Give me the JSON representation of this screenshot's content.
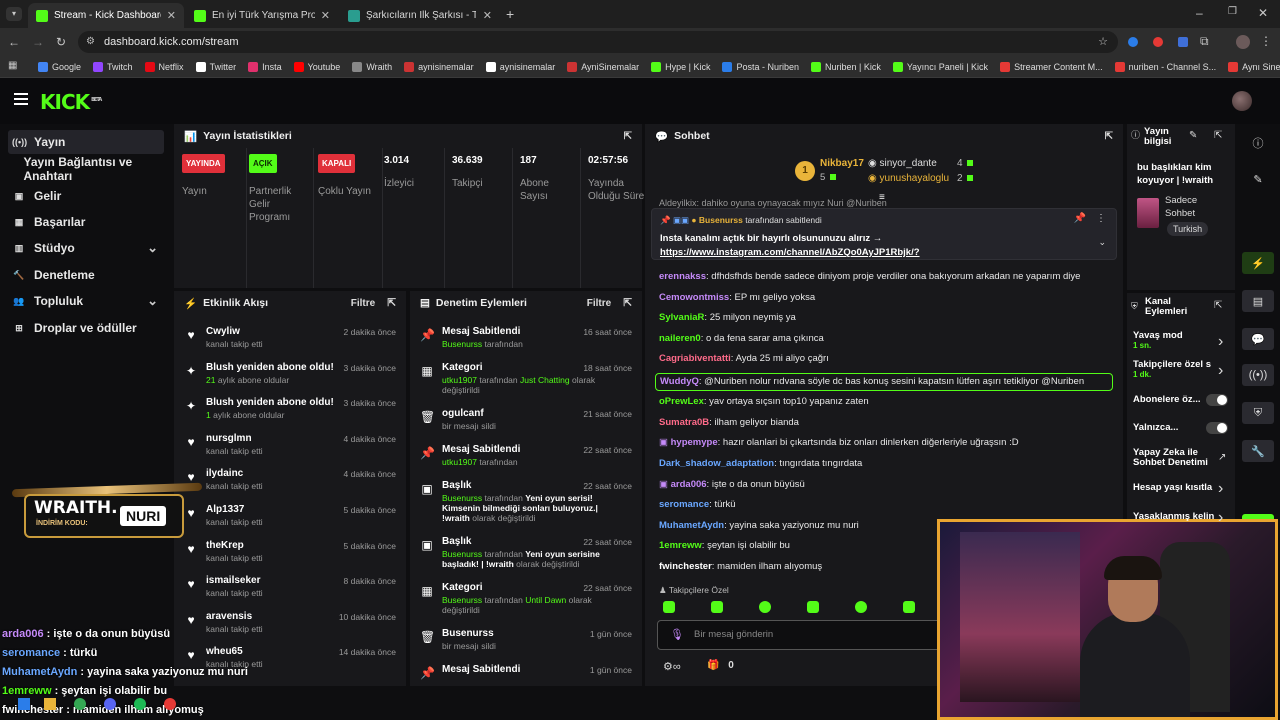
{
  "browser": {
    "tabs": [
      {
        "label": "Stream - Kick Dashboard",
        "active": true,
        "color": "#53fc18"
      },
      {
        "label": "En iyi Türk Yarışma Programı? -",
        "active": false,
        "color": "#53fc18"
      },
      {
        "label": "Şarkıcıların İlk Şarkısı - Tier List",
        "active": false,
        "color": "#2a9d8f"
      }
    ],
    "url": "dashboard.kick.com/stream",
    "bookmarks": [
      "Google",
      "Twitch",
      "Netflix",
      "Twitter",
      "Insta",
      "Youtube",
      "Wraith",
      "aynisinemalar",
      "aynisinemalar",
      "AyniSinemalar",
      "Hype | Kick",
      "Posta - Nuriben",
      "Nuriben | Kick",
      "Yayıncı Paneli | Kick",
      "Streamer Content M...",
      "nuriben - Channel S...",
      "Aynı Sinemalar - Ça..."
    ]
  },
  "brand": {
    "logo": "KICK",
    "beta": "BETA",
    "accent": "#53fc18"
  },
  "sidebar": [
    {
      "label": "Yayın",
      "icon": "broadcast-icon",
      "active": true
    },
    {
      "label": "Yayın Bağlantısı ve Anahtarı",
      "icon": "",
      "active": false
    },
    {
      "label": "Gelir",
      "icon": "wallet-icon",
      "active": false
    },
    {
      "label": "Başarılar",
      "icon": "achievements-icon",
      "active": false
    },
    {
      "label": "Stüdyo",
      "icon": "studio-icon",
      "active": false,
      "chevron": true
    },
    {
      "label": "Denetleme",
      "icon": "moderation-icon",
      "active": false
    },
    {
      "label": "Topluluk",
      "icon": "community-icon",
      "active": false,
      "chevron": true
    },
    {
      "label": "Droplar ve ödüller",
      "icon": "drops-icon",
      "active": false
    }
  ],
  "stats": {
    "title": "Yayın İstatistikleri",
    "items": [
      {
        "badge": "YAYINDA",
        "badge_bg": "#e0303a",
        "label": "Yayın"
      },
      {
        "badge": "AÇIK",
        "badge_bg": "#53fc18",
        "label": "Partnerlik Gelir Programı"
      },
      {
        "badge": "KAPALI",
        "badge_bg": "#e0303a",
        "label": "Çoklu Yayın"
      },
      {
        "value": "3.014",
        "label": "İzleyici"
      },
      {
        "value": "36.639",
        "label": "Takipçi"
      },
      {
        "value": "187",
        "label": "Abone Sayısı"
      },
      {
        "value": "02:57:56",
        "label": "Yayında Olduğu Süre"
      }
    ]
  },
  "activity": {
    "title": "Etkinlik Akışı",
    "filter": "Filtre",
    "items": [
      {
        "icon": "heart",
        "name": "Cwyliw",
        "sub": "kanalı takip etti",
        "time": "2 dakika önce"
      },
      {
        "icon": "sparkle",
        "name": "Blush yeniden abone oldu!",
        "sub_hl": "21",
        "sub": " aylık abone oldular",
        "time": "3 dakika önce"
      },
      {
        "icon": "sparkle",
        "name": "Blush yeniden abone oldu!",
        "sub_hl": "1",
        "sub": " aylık abone oldular",
        "time": "3 dakika önce"
      },
      {
        "icon": "heart",
        "name": "nursglmn",
        "sub": "kanalı takip etti",
        "time": "4 dakika önce"
      },
      {
        "icon": "heart",
        "name": "ilydainc",
        "sub": "kanalı takip etti",
        "time": "4 dakika önce"
      },
      {
        "icon": "heart",
        "name": "Alp1337",
        "sub": "kanalı takip etti",
        "time": "5 dakika önce"
      },
      {
        "icon": "heart",
        "name": "theKrep",
        "sub": "kanalı takip etti",
        "time": "5 dakika önce"
      },
      {
        "icon": "heart",
        "name": "ismailseker",
        "sub": "kanalı takip etti",
        "time": "8 dakika önce"
      },
      {
        "icon": "heart",
        "name": "aravensis",
        "sub": "kanalı takip etti",
        "time": "10 dakika önce"
      },
      {
        "icon": "heart",
        "name": "wheu65",
        "sub": "kanalı takip etti",
        "time": "14 dakika önce"
      }
    ]
  },
  "modlog": {
    "title": "Denetim Eylemleri",
    "filter": "Filtre",
    "items": [
      {
        "icon": "pin",
        "title": "Mesaj Sabitlendi",
        "sub_hl": "Busenurss",
        "sub": " tarafından",
        "time": "16 saat önce",
        "h": 36
      },
      {
        "icon": "cat",
        "title": "Kategori",
        "sub_hl": "utku1907",
        "sub": " tarafından ",
        "sub_hl2": "Just Chatting",
        "sub2": " olarak değiştirildi",
        "time": "18 saat önce",
        "h": 46
      },
      {
        "icon": "trash",
        "title": "ogulcanf",
        "sub_hl": "",
        "sub": "bir mesajı sildi",
        "time": "21 saat önce",
        "h": 36
      },
      {
        "icon": "pin",
        "title": "Mesaj Sabitlendi",
        "sub_hl": "utku1907",
        "sub": " tarafından",
        "time": "22 saat önce",
        "h": 36
      },
      {
        "icon": "title",
        "title": "Başlık",
        "sub_hl": "Busenurss",
        "sub": " tarafından ",
        "sub_w": "Yeni oyun serisi! Kimsenin bilmediği sonları buluyoruz.| !wraith",
        "sub2": " olarak değiştirildi",
        "time": "22 saat önce",
        "h": 56
      },
      {
        "icon": "title",
        "title": "Başlık",
        "sub_hl": "Busenurss",
        "sub": " tarafından ",
        "sub_w": "Yeni oyun serisine başladık! | !wraith",
        "sub2": " olarak değiştirildi",
        "time": "22 saat önce",
        "h": 46
      },
      {
        "icon": "cat",
        "title": "Kategori",
        "sub_hl": "Busenurss",
        "sub": " tarafından ",
        "sub_hl2": "Until Dawn",
        "sub2": " olarak değiştirildi",
        "time": "22 saat önce",
        "h": 46
      },
      {
        "icon": "trash",
        "title": "Busenurss",
        "sub_hl": "",
        "sub": "bir mesajı sildi",
        "time": "1 gün önce",
        "h": 36
      },
      {
        "icon": "pin",
        "title": "Mesaj Sabitlendi",
        "sub_hl": "",
        "sub": "",
        "time": "1 gün önce",
        "h": 20
      }
    ]
  },
  "chat": {
    "title": "Sohbet",
    "leaderboard": [
      {
        "rank": "1",
        "name": "Nikbay17",
        "count": "5"
      },
      {
        "name": "sinyor_dante",
        "count": "4"
      },
      {
        "name": "yunushayaloglu",
        "count": "2"
      }
    ],
    "top_partial": "Aldeyilkix: dahiko oyuna oynayacak mıyız Nuri @Nuriben",
    "pinned": {
      "by": "Busenurss",
      "by_suffix": " tarafından sabitlendi",
      "text": "Insta kanalını açtık bir hayırlı olsununuzu alırız →",
      "link": "https://www.instagram.com/channel/AbZQo0AyJP1Rbjk/?"
    },
    "messages": [
      {
        "user": "erennakss",
        "color": "#c58af9",
        "text": "dfhdsfhds bende sadece diniyom proje verdiler ona bakıyorum arkadan ne yaparım diye"
      },
      {
        "user": "Cemowontmiss",
        "color": "#c58af9",
        "text": "EP mı geliyo yoksa"
      },
      {
        "user": "SylvaniaR",
        "color": "#53fc18",
        "text": "25 milyon neymiş ya"
      },
      {
        "user": "naileren0",
        "color": "#53fc18",
        "text": "o da fena sarar ama çıkınca"
      },
      {
        "user": "Cagriabiventatti",
        "color": "#ff6b8a",
        "text": "Ayda 25 mi aliyo çağrı"
      },
      {
        "user": "WuddyQ",
        "color": "#c58af9",
        "text": "@Nuriben nolur rıdvana söyle dc bas konuş sesini kapatsın lütfen aşırı tetikliyor @Nuriben",
        "highlight": true
      },
      {
        "user": "oPrewLex",
        "color": "#53fc18",
        "text": "yav ortaya sıçsın top10 yapanız zaten"
      },
      {
        "user": "Sumatra0B",
        "color": "#ff6b8a",
        "text": "ilham geliyor bianda"
      },
      {
        "user": "hypemype",
        "color": "#c58af9",
        "text": "hazır olanlari bi çıkartsında biz onları dinlerken diğerleriyle uğraşsın :D",
        "badge": true
      },
      {
        "user": "Dark_shadow_adaptation",
        "color": "#6aa7ff",
        "text": "tıngırdata tıngırdata"
      },
      {
        "user": "arda006",
        "color": "#c58af9",
        "text": "işte o da onun büyüsü",
        "badge": true
      },
      {
        "user": "seromance",
        "color": "#6aa7ff",
        "text": "türkü"
      },
      {
        "user": "MuhametAydn",
        "color": "#6aa7ff",
        "text": "yayina saka yaziyonuz mu nuri"
      },
      {
        "user": "1emreww",
        "color": "#53fc18",
        "text": "şeytan işi olabilir bu"
      },
      {
        "user": "fwinchester",
        "color": "#ffffff",
        "text": "mamiden ilham alıyomuş"
      }
    ],
    "followers_only": "Takipçilere Özel",
    "placeholder": "Bir mesaj gönderin",
    "gift_count": "0"
  },
  "stream_info": {
    "title": "Yayın bilgisi",
    "stream_title": "bu başlıkları kim koyuyor | !wraith",
    "category": "Sadece Sohbet",
    "tag": "Turkish"
  },
  "channel_actions": {
    "title": "Kanal Eylemleri",
    "items": [
      {
        "label": "Yavaş mod",
        "sub": "1 sn.",
        "type": "chevron"
      },
      {
        "label": "Takipçilere özel s",
        "sub": "1 dk.",
        "type": "chevron"
      },
      {
        "label": "Abonelere öz...",
        "type": "toggle"
      },
      {
        "label": "Yalnızca...",
        "type": "toggle"
      },
      {
        "label": "Yapay Zeka ile Sohbet Denetimi",
        "type": "link"
      },
      {
        "label": "Hesap yaşı kısıtla",
        "type": "chevron"
      },
      {
        "label": "Yasaklanmış kelin",
        "type": "chevron"
      }
    ]
  },
  "overlay": {
    "sponsor": "WRAITH.",
    "code_label": "İNDİRİM KODU:",
    "code": "NURI",
    "chat": [
      {
        "user": "arda006",
        "text": " : işte o da onun büyüsü",
        "color": "#c58af9"
      },
      {
        "user": "seromance",
        "text": " : türkü",
        "color": "#6aa7ff"
      },
      {
        "user": "MuhametAydn",
        "text": " : yayina saka yaziyonuz mu nuri",
        "color": "#6aa7ff"
      },
      {
        "user": "1emreww",
        "text": " : şeytan işi olabilir bu",
        "color": "#53fc18"
      },
      {
        "user": "fwinchester",
        "text": " : mamiden ilham alıyomuş",
        "color": "#ffffff"
      }
    ]
  }
}
